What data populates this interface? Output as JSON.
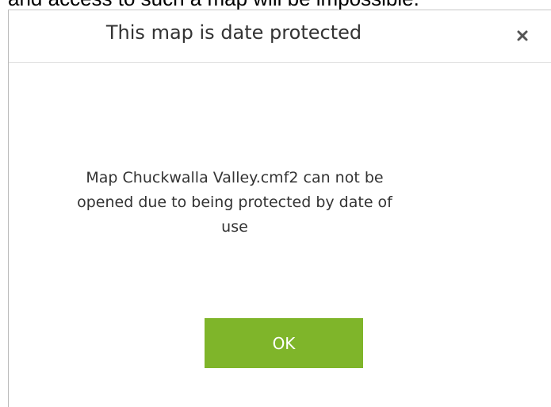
{
  "background": {
    "partial_text": "and access to such a map will be impossible."
  },
  "dialog": {
    "title": "This map is date protected",
    "message": "Map Chuckwalla Valley.cmf2 can not be opened due to being protected by date of use",
    "ok_label": "OK",
    "close_icon": "close-icon"
  },
  "colors": {
    "ok_button_bg": "#7fb52a",
    "ok_button_text": "#ffffff",
    "title_text": "#333333",
    "message_text": "#333333"
  }
}
